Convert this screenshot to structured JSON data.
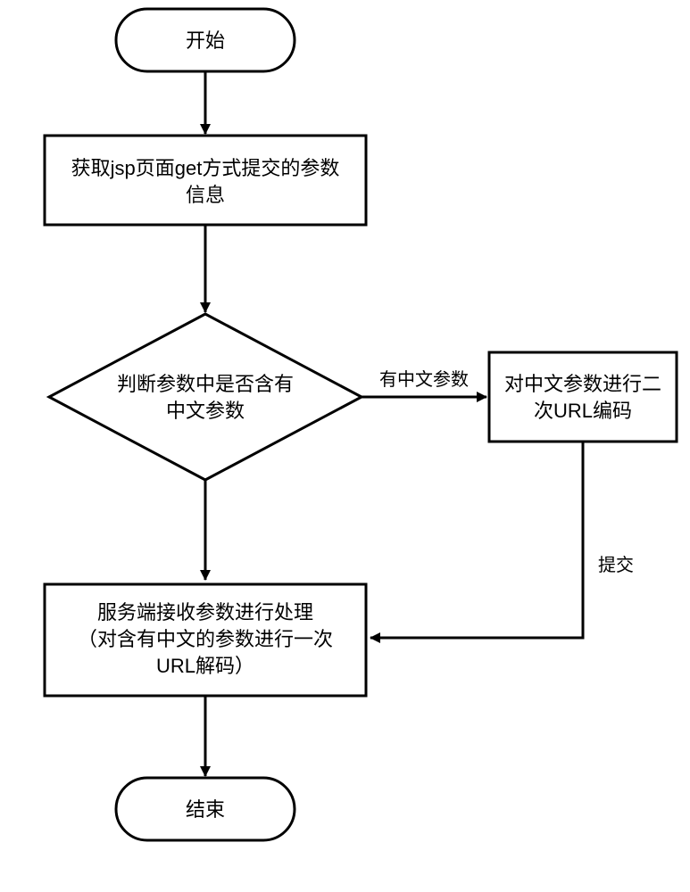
{
  "chart_data": {
    "type": "flowchart",
    "nodes": [
      {
        "id": "start",
        "shape": "terminator",
        "label": "开始"
      },
      {
        "id": "acquire",
        "shape": "process",
        "label_lines": [
          "获取jsp页面get方式提交的参数",
          "信息"
        ]
      },
      {
        "id": "decide",
        "shape": "decision",
        "label_lines": [
          "判断参数中是否含有",
          "中文参数"
        ]
      },
      {
        "id": "encode",
        "shape": "process",
        "label_lines": [
          "对中文参数进行二",
          "次URL编码"
        ]
      },
      {
        "id": "server",
        "shape": "process",
        "label_lines": [
          "服务端接收参数进行处理",
          "（对含有中文的参数进行一次",
          "URL解码）"
        ]
      },
      {
        "id": "end",
        "shape": "terminator",
        "label": "结束"
      }
    ],
    "edges": [
      {
        "from": "start",
        "to": "acquire",
        "label": ""
      },
      {
        "from": "acquire",
        "to": "decide",
        "label": ""
      },
      {
        "from": "decide",
        "to": "encode",
        "label": "有中文参数"
      },
      {
        "from": "decide",
        "to": "server",
        "label": ""
      },
      {
        "from": "encode",
        "to": "server",
        "label": "提交"
      },
      {
        "from": "server",
        "to": "end",
        "label": ""
      }
    ]
  },
  "labels": {
    "start": "开始",
    "acquire_l1": "获取jsp页面get方式提交的参数",
    "acquire_l2": "信息",
    "decide_l1": "判断参数中是否含有",
    "decide_l2": "中文参数",
    "encode_l1": "对中文参数进行二",
    "encode_l2": "次URL编码",
    "server_l1": "服务端接收参数进行处理",
    "server_l2": "（对含有中文的参数进行一次",
    "server_l3": "URL解码）",
    "end": "结束",
    "edge_has_cn": "有中文参数",
    "edge_submit": "提交"
  }
}
